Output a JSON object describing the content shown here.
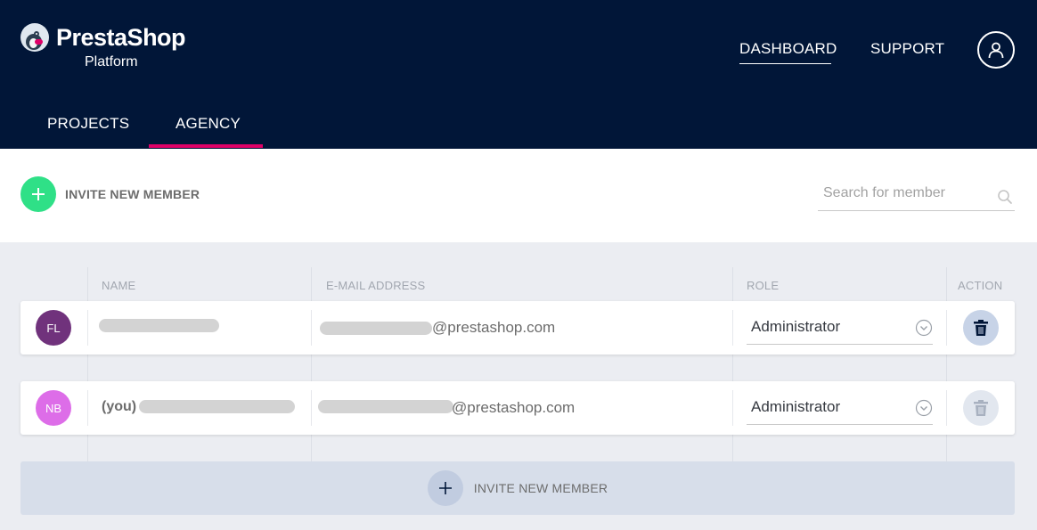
{
  "brand": {
    "name": "PrestaShop",
    "subtitle": "Platform"
  },
  "top_nav": {
    "dashboard": "DASHBOARD",
    "support": "SUPPORT"
  },
  "tabs": [
    {
      "label": "PROJECTS",
      "active": false
    },
    {
      "label": "AGENCY",
      "active": true
    }
  ],
  "toolbar": {
    "invite_label": "INVITE NEW MEMBER",
    "search_placeholder": "Search for member"
  },
  "table": {
    "headers": {
      "name": "NAME",
      "email": "E-MAIL ADDRESS",
      "role": "ROLE",
      "action": "ACTION"
    },
    "rows": [
      {
        "initials": "FL",
        "avatar_color": "#70327c",
        "name_prefix": "",
        "email_domain": "@prestashop.com",
        "role": "Administrator",
        "delete_enabled": true
      },
      {
        "initials": "NB",
        "avatar_color": "#dd6de8",
        "name_prefix": "(you)",
        "email_domain": "@prestashop.com",
        "role": "Administrator",
        "delete_enabled": false
      }
    ]
  },
  "footer": {
    "invite_label": "INVITE NEW MEMBER"
  },
  "colors": {
    "header_bg": "#011638",
    "accent": "#df0067",
    "add_green": "#2fe087",
    "annotation_red": "#d9232a"
  },
  "icons": [
    "user-icon",
    "plus-icon",
    "search-icon",
    "chevron-down-icon",
    "trash-icon",
    "arrow-annotation"
  ]
}
